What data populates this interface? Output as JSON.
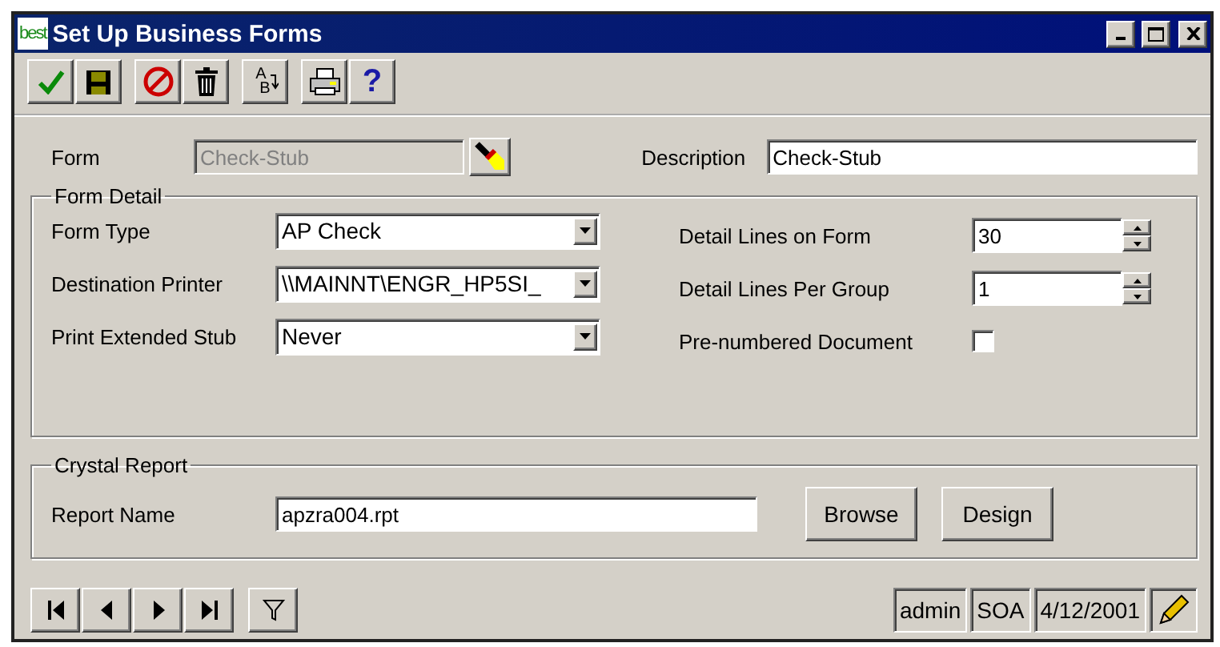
{
  "window": {
    "logo": "best",
    "title": "Set Up Business Forms"
  },
  "toolbar": [
    [
      {
        "kind": "check"
      },
      {
        "kind": "save"
      }
    ],
    [
      {
        "kind": "cancel"
      },
      {
        "kind": "delete"
      }
    ],
    [
      {
        "kind": "sort",
        "letters": [
          "A",
          "B"
        ]
      }
    ],
    [
      {
        "kind": "print"
      },
      {
        "kind": "help",
        "glyph": "?"
      }
    ]
  ],
  "form": {
    "label": "Form",
    "value": "Check-Stub",
    "disabled": true
  },
  "description": {
    "label": "Description",
    "value": "Check-Stub"
  },
  "form_detail": {
    "title": "Form Detail",
    "left": [
      {
        "label": "Form Type",
        "kind": "combo",
        "value": "AP Check"
      },
      {
        "label": "Destination Printer",
        "kind": "combo",
        "value": "\\\\MAINNT\\ENGR_HP5SI_"
      },
      {
        "label": "Print Extended Stub",
        "kind": "combo",
        "value": "Never"
      }
    ],
    "right": [
      {
        "label": "Detail Lines on Form",
        "kind": "spinner",
        "value": "30"
      },
      {
        "label": "Detail Lines Per Group",
        "kind": "spinner",
        "value": "1"
      },
      {
        "label": "Pre-numbered Document",
        "kind": "checkbox",
        "checked": false
      }
    ]
  },
  "crystal_report": {
    "title": "Crystal Report",
    "label": "Report Name",
    "value": "apzra004.rpt",
    "buttons": [
      "Browse",
      "Design"
    ]
  },
  "navigation": [
    {
      "kind": "first"
    },
    {
      "kind": "previous"
    },
    {
      "kind": "next"
    },
    {
      "kind": "last"
    },
    {
      "kind": "filter"
    }
  ],
  "status_bar": [
    "admin",
    "SOA",
    "4/12/2001"
  ]
}
